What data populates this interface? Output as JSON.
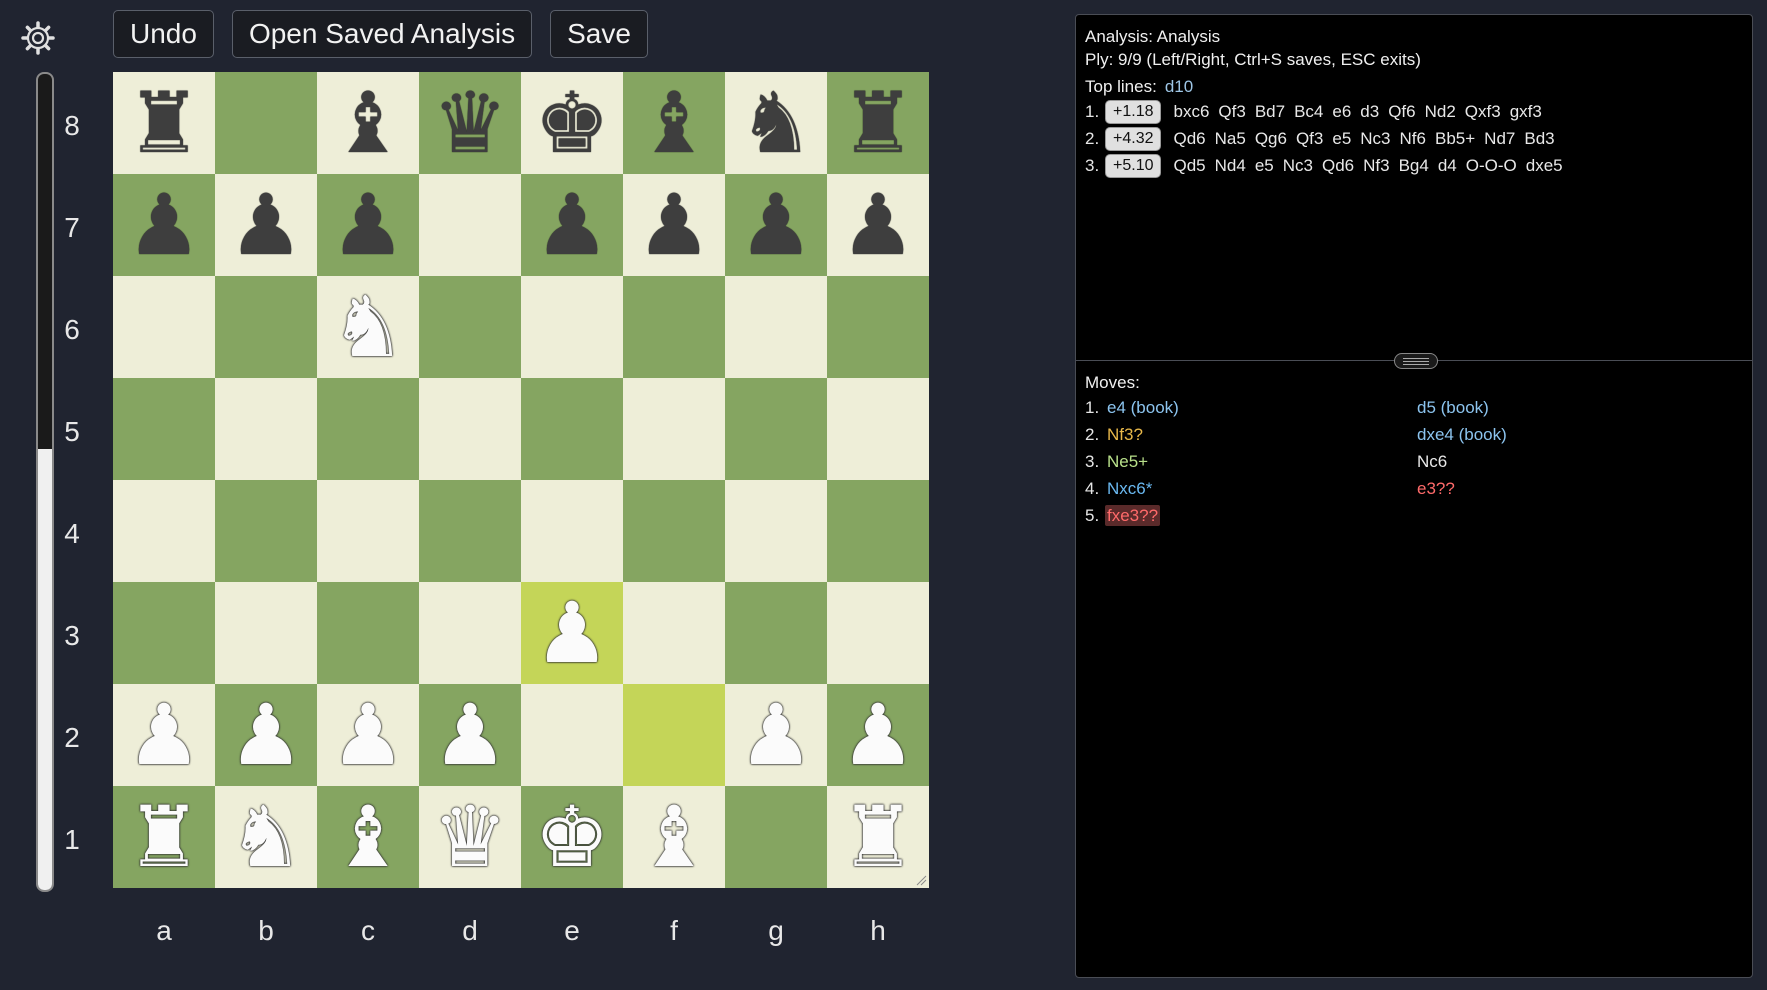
{
  "toolbar": {
    "undo_label": "Undo",
    "open_label": "Open Saved Analysis",
    "save_label": "Save"
  },
  "settings_icon": "gear-icon",
  "eval_bar": {
    "white_fraction": 0.54
  },
  "board": {
    "ranks": [
      "8",
      "7",
      "6",
      "5",
      "4",
      "3",
      "2",
      "1"
    ],
    "files": [
      "a",
      "b",
      "c",
      "d",
      "e",
      "f",
      "g",
      "h"
    ],
    "position": [
      [
        "bR",
        "",
        "bB",
        "bQ",
        "bK",
        "bB",
        "bN",
        "bR"
      ],
      [
        "bP",
        "bP",
        "bP",
        "",
        "bP",
        "bP",
        "bP",
        "bP"
      ],
      [
        "",
        "",
        "wN",
        "",
        "",
        "",
        "",
        ""
      ],
      [
        "",
        "",
        "",
        "",
        "",
        "",
        "",
        ""
      ],
      [
        "",
        "",
        "",
        "",
        "",
        "",
        "",
        ""
      ],
      [
        "",
        "",
        "",
        "",
        "wP",
        "",
        "",
        ""
      ],
      [
        "wP",
        "wP",
        "wP",
        "wP",
        "",
        "",
        "wP",
        "wP"
      ],
      [
        "wR",
        "wN",
        "wB",
        "wQ",
        "wK",
        "wB",
        "",
        "wR"
      ]
    ],
    "highlight_squares": [
      "e3",
      "f2"
    ],
    "colors": {
      "light": "#eeeed8",
      "dark": "#85a561",
      "highlight": "#c4d558"
    }
  },
  "analysis": {
    "title": "Analysis: Analysis",
    "ply": "Ply: 9/9 (Left/Right, Ctrl+S saves, ESC exits)",
    "top_lines_label": "Top lines:",
    "depth": "d10",
    "lines": [
      {
        "num": "1.",
        "eval": "+1.18",
        "moves": [
          "bxc6",
          "Qf3",
          "Bd7",
          "Bc4",
          "e6",
          "d3",
          "Qf6",
          "Nd2",
          "Qxf3",
          "gxf3"
        ]
      },
      {
        "num": "2.",
        "eval": "+4.32",
        "moves": [
          "Qd6",
          "Na5",
          "Qg6",
          "Qf3",
          "e5",
          "Nc3",
          "Nf6",
          "Bb5+",
          "Nd7",
          "Bd3"
        ]
      },
      {
        "num": "3.",
        "eval": "+5.10",
        "moves": [
          "Qd5",
          "Nd4",
          "e5",
          "Nc3",
          "Qd6",
          "Nf3",
          "Bg4",
          "d4",
          "O-O-O",
          "dxe5"
        ]
      }
    ]
  },
  "moves": {
    "label": "Moves:",
    "rows": [
      {
        "num": "1.",
        "white": "e4 (book)",
        "white_class": "book",
        "black": "d5 (book)",
        "black_class": "book"
      },
      {
        "num": "2.",
        "white": "Nf3?",
        "white_class": "inacc",
        "black": "dxe4 (book)",
        "black_class": "book"
      },
      {
        "num": "3.",
        "white": "Ne5+",
        "white_class": "good",
        "black": "Nc6",
        "black_class": "neutral"
      },
      {
        "num": "4.",
        "white": "Nxc6*",
        "white_class": "interest",
        "black": "e3??",
        "black_class": "blunder"
      },
      {
        "num": "5.",
        "white": "fxe3??",
        "white_class": "blunder current",
        "black": "",
        "black_class": ""
      }
    ]
  }
}
